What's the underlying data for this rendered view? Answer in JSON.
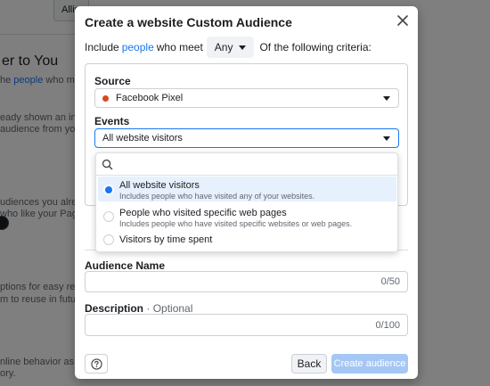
{
  "background": {
    "top_button": "Allis",
    "title": "er to You",
    "lines": [
      {
        "pre": "he ",
        "link": "people",
        "post": " who matter"
      },
      {
        "pre": "eady shown an interes",
        "link": "",
        "post": ""
      },
      {
        "pre": " audience from your c",
        "link": "",
        "post": ""
      },
      {
        "pre": "udiences you already",
        "link": "",
        "post": ""
      },
      {
        "pre": "who like your Page, cor",
        "link": "",
        "post": ""
      },
      {
        "pre": "ptions for easy reuse.",
        "link": "",
        "post": ""
      },
      {
        "pre": "m to reuse in future a",
        "link": "",
        "post": ""
      },
      {
        "pre": "nline behavior as your",
        "link": "",
        "post": ""
      },
      {
        "pre": "ory.",
        "link": "",
        "post": ""
      }
    ]
  },
  "modal": {
    "title": "Create a website Custom Audience",
    "include": {
      "prefix": "Include",
      "link": "people",
      "middle": "who meet",
      "any_value": "Any",
      "suffix": "Of the following criteria:"
    },
    "source": {
      "label": "Source",
      "value": "Facebook Pixel",
      "dot_color": "#d4491d"
    },
    "events": {
      "label": "Events",
      "value": "All website visitors"
    },
    "dropdown": {
      "search_placeholder": "",
      "options": [
        {
          "title": "All website visitors",
          "subtitle": "Includes people who have visited any of your websites.",
          "selected": true
        },
        {
          "title": "People who visited specific web pages",
          "subtitle": "Includes people who have visited specific websites or web pages.",
          "selected": false
        },
        {
          "title": "Visitors by time spent",
          "subtitle": "",
          "selected": false
        }
      ]
    },
    "audience_name": {
      "label": "Audience Name",
      "value": "",
      "counter": "0/50"
    },
    "description": {
      "label": "Description",
      "optional": "· Optional",
      "value": "",
      "counter": "0/100"
    },
    "footer": {
      "back_label": "Back",
      "create_label": "Create audience"
    }
  },
  "colors": {
    "accent": "#1877f2",
    "primary_disabled": "#a4c7f5"
  }
}
